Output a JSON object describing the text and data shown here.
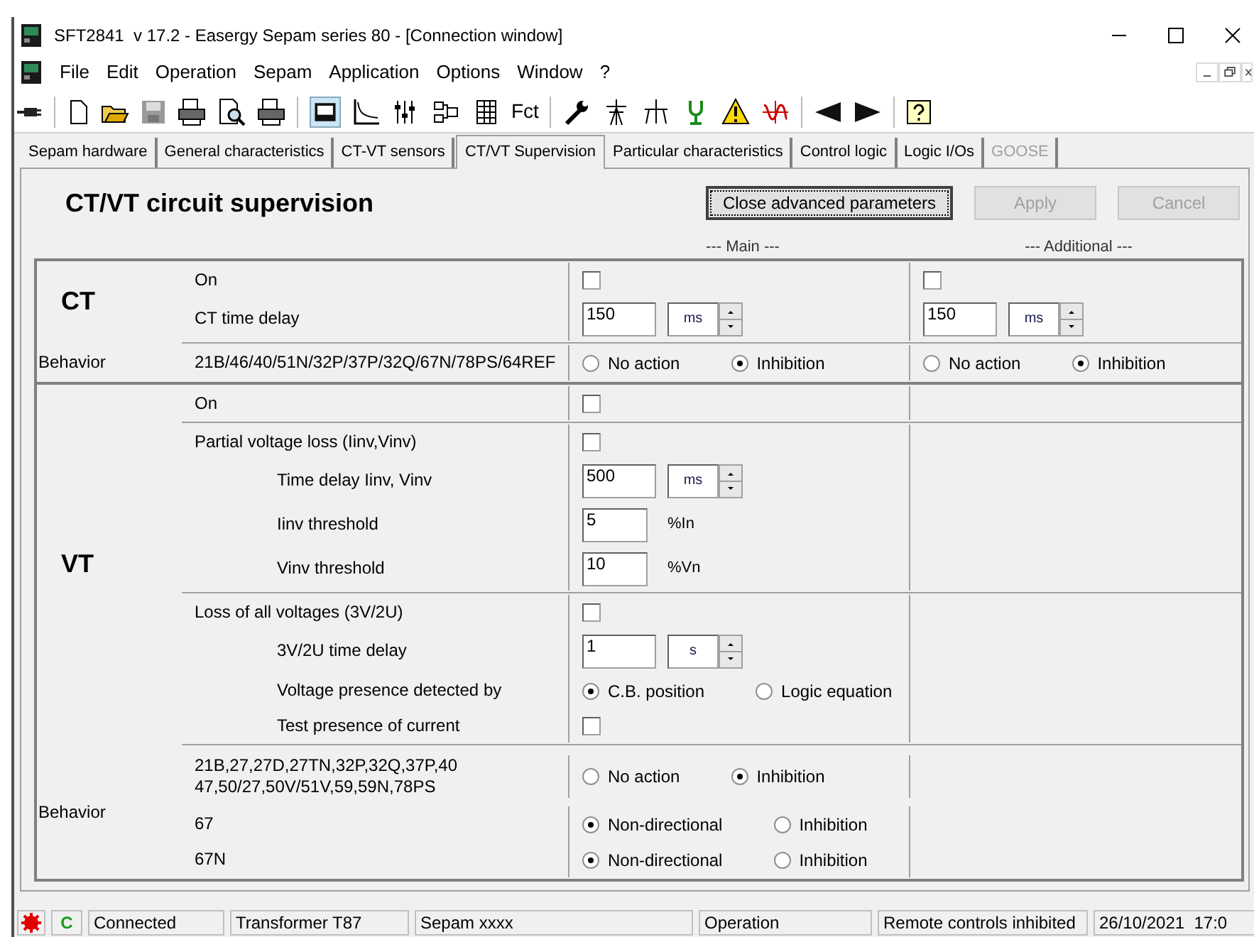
{
  "window": {
    "title": "SFT2841  v 17.2 - Easergy Sepam series 80 - [Connection window]"
  },
  "menu": [
    "File",
    "Edit",
    "Operation",
    "Sepam",
    "Application",
    "Options",
    "Window",
    "?"
  ],
  "toolbar": {
    "fct_label": "Fct"
  },
  "tabs": [
    {
      "label": "Sepam hardware",
      "selected": false,
      "disabled": false
    },
    {
      "label": "General characteristics",
      "selected": false,
      "disabled": false
    },
    {
      "label": "CT-VT sensors",
      "selected": false,
      "disabled": false
    },
    {
      "label": "CT/VT Supervision",
      "selected": true,
      "disabled": false
    },
    {
      "label": "Particular characteristics",
      "selected": false,
      "disabled": false
    },
    {
      "label": "Control logic",
      "selected": false,
      "disabled": false
    },
    {
      "label": "Logic I/Os",
      "selected": false,
      "disabled": false
    },
    {
      "label": "GOOSE",
      "selected": false,
      "disabled": true
    }
  ],
  "heading": "CT/VT circuit supervision",
  "buttons": [
    {
      "label": "Close advanced parameters",
      "disabled": false
    },
    {
      "label": "Apply",
      "disabled": true
    },
    {
      "label": "Cancel",
      "disabled": true
    }
  ],
  "column_headers": [
    "--- Main ---",
    "--- Additional ---"
  ],
  "sections": [
    {
      "title": "CT",
      "groups": [
        {
          "rows": [
            {
              "label": "On",
              "main": {
                "kind": "checkbox",
                "checked": false
              },
              "additional": {
                "kind": "checkbox",
                "checked": false
              }
            },
            {
              "label": "CT time delay",
              "main": {
                "kind": "spin",
                "value": "150",
                "unit": "ms"
              },
              "additional": {
                "kind": "spin",
                "value": "150",
                "unit": "ms"
              }
            }
          ]
        }
      ],
      "behavior": {
        "label": "Behavior",
        "rows": [
          {
            "label": "21B/46/40/51N/32P/37P/32Q/67N/78PS/64REF",
            "main": {
              "kind": "radios",
              "options": [
                {
                  "label": "No action",
                  "selected": false
                },
                {
                  "label": "Inhibition",
                  "selected": true
                }
              ]
            },
            "additional": {
              "kind": "radios",
              "options": [
                {
                  "label": "No action",
                  "selected": false
                },
                {
                  "label": "Inhibition",
                  "selected": true
                }
              ]
            }
          }
        ]
      }
    },
    {
      "title": "VT",
      "groups": [
        {
          "rows": [
            {
              "label": "On",
              "main": {
                "kind": "checkbox",
                "checked": false
              }
            }
          ]
        },
        {
          "rows": [
            {
              "label": "Partial voltage loss (Iinv,Vinv)",
              "main": {
                "kind": "checkbox",
                "checked": false
              },
              "children": [
                {
                  "label": "Time delay Iinv, Vinv",
                  "main": {
                    "kind": "spin",
                    "value": "500",
                    "unit": "ms"
                  }
                },
                {
                  "label": "Iinv threshold",
                  "main": {
                    "kind": "number",
                    "value": "5",
                    "unit": "%In"
                  }
                },
                {
                  "label": "Vinv threshold",
                  "main": {
                    "kind": "number",
                    "value": "10",
                    "unit": "%Vn"
                  }
                }
              ]
            }
          ]
        },
        {
          "rows": [
            {
              "label": "Loss of all voltages (3V/2U)",
              "main": {
                "kind": "checkbox",
                "checked": false
              },
              "children": [
                {
                  "label": "3V/2U time delay",
                  "main": {
                    "kind": "spin",
                    "value": "1",
                    "unit": "s"
                  }
                },
                {
                  "label": "Voltage presence detected by",
                  "main": {
                    "kind": "radios",
                    "options": [
                      {
                        "label": "C.B. position",
                        "selected": true
                      },
                      {
                        "label": "Logic equation",
                        "selected": false
                      }
                    ]
                  }
                },
                {
                  "label": "Test presence of current",
                  "main": {
                    "kind": "checkbox",
                    "checked": false
                  }
                }
              ]
            }
          ]
        }
      ],
      "behavior": {
        "label": "Behavior",
        "rows": [
          {
            "label": "21B,27,27D,27TN,32P,32Q,37P,40\n47,50/27,50V/51V,59,59N,78PS",
            "main": {
              "kind": "radios",
              "options": [
                {
                  "label": "No action",
                  "selected": false
                },
                {
                  "label": "Inhibition",
                  "selected": true
                }
              ]
            }
          },
          {
            "label": "67",
            "main": {
              "kind": "radios",
              "options": [
                {
                  "label": "Non-directional",
                  "selected": true
                },
                {
                  "label": "Inhibition",
                  "selected": false
                }
              ]
            }
          },
          {
            "label": "67N",
            "main": {
              "kind": "radios",
              "options": [
                {
                  "label": "Non-directional",
                  "selected": true
                },
                {
                  "label": "Inhibition",
                  "selected": false
                }
              ]
            }
          }
        ]
      }
    }
  ],
  "status_bar": {
    "indicator": "C",
    "fields": [
      "Connected",
      "Transformer T87",
      "Sepam xxxx",
      "Operation",
      "Remote controls inhibited",
      "26/10/2021  17:0"
    ]
  }
}
